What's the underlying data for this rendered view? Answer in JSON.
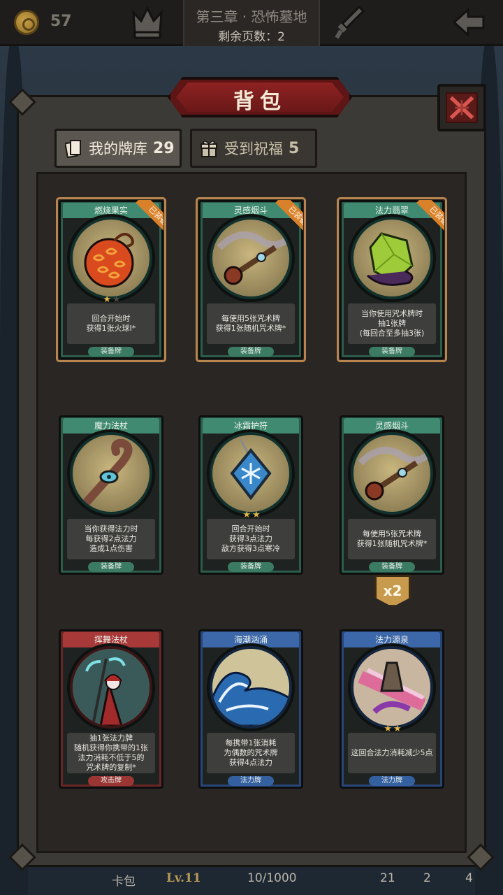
{
  "topbar": {
    "coins": "57",
    "chapter_title": "第三章 · 恐怖墓地",
    "pages_left": "剩余页数：2"
  },
  "panel": {
    "title": "背包"
  },
  "tabs": [
    {
      "label": "我的牌库",
      "count": "29"
    },
    {
      "label": "受到祝福",
      "count": "5"
    }
  ],
  "cards": [
    {
      "name": "燃烧果实",
      "desc": [
        "回合开始时",
        "获得1张火球I*"
      ],
      "type": "装备牌",
      "color": "green",
      "equipped": true,
      "equipped_label": "已装备",
      "stars": 1,
      "stars_max": 2
    },
    {
      "name": "灵感烟斗",
      "desc": [
        "每使用5张咒术牌",
        "获得1张随机咒术牌*"
      ],
      "type": "装备牌",
      "color": "green",
      "equipped": true,
      "equipped_label": "已装备",
      "stars": 0,
      "stars_max": 0
    },
    {
      "name": "法力翡翠",
      "desc": [
        "当你使用咒术牌时",
        "抽1张牌",
        "(每回合至多抽3张)"
      ],
      "type": "装备牌",
      "color": "green",
      "equipped": true,
      "equipped_label": "已装备",
      "stars": 0,
      "stars_max": 0
    },
    {
      "name": "魔力法杖",
      "desc": [
        "当你获得法力时",
        "每获得2点法力",
        "造成1点伤害"
      ],
      "type": "装备牌",
      "color": "green",
      "equipped": false,
      "stars": 0,
      "stars_max": 0
    },
    {
      "name": "冰霜护符",
      "desc": [
        "回合开始时",
        "获得3点法力",
        "敌方获得3点寒冷"
      ],
      "type": "装备牌",
      "color": "green",
      "equipped": false,
      "stars": 2,
      "stars_max": 2
    },
    {
      "name": "灵感烟斗",
      "desc": [
        "每使用5张咒术牌",
        "获得1张随机咒术牌*"
      ],
      "type": "装备牌",
      "color": "green",
      "equipped": false,
      "stars": 0,
      "stars_max": 0,
      "multiplier": "x2"
    },
    {
      "name": "挥舞法杖",
      "desc": [
        "抽1张法力牌",
        "随机获得你携带的1张",
        "法力消耗不低于5的",
        "咒术牌的复制*"
      ],
      "type": "攻击牌",
      "color": "red",
      "equipped": false,
      "stars": 0,
      "stars_max": 0
    },
    {
      "name": "海潮汹涌",
      "desc": [
        "每携带1张消耗",
        "为偶数的咒术牌",
        "获得4点法力"
      ],
      "type": "法力牌",
      "color": "blue",
      "equipped": false,
      "stars": 0,
      "stars_max": 0
    },
    {
      "name": "法力源泉",
      "desc": [
        "这回合法力消耗减少5点"
      ],
      "type": "法力牌",
      "color": "blue",
      "equipped": false,
      "stars": 2,
      "stars_max": 2
    }
  ],
  "bottom": {
    "tab": "卡包",
    "level": "Lv.11",
    "xp": "10/1000",
    "stat1": "21",
    "stat2": "2",
    "stat3": "4"
  },
  "colors": {
    "equipped_border": "#b9854f",
    "equip_ribbon": "#d9812a",
    "title_banner": "#8e2222"
  }
}
